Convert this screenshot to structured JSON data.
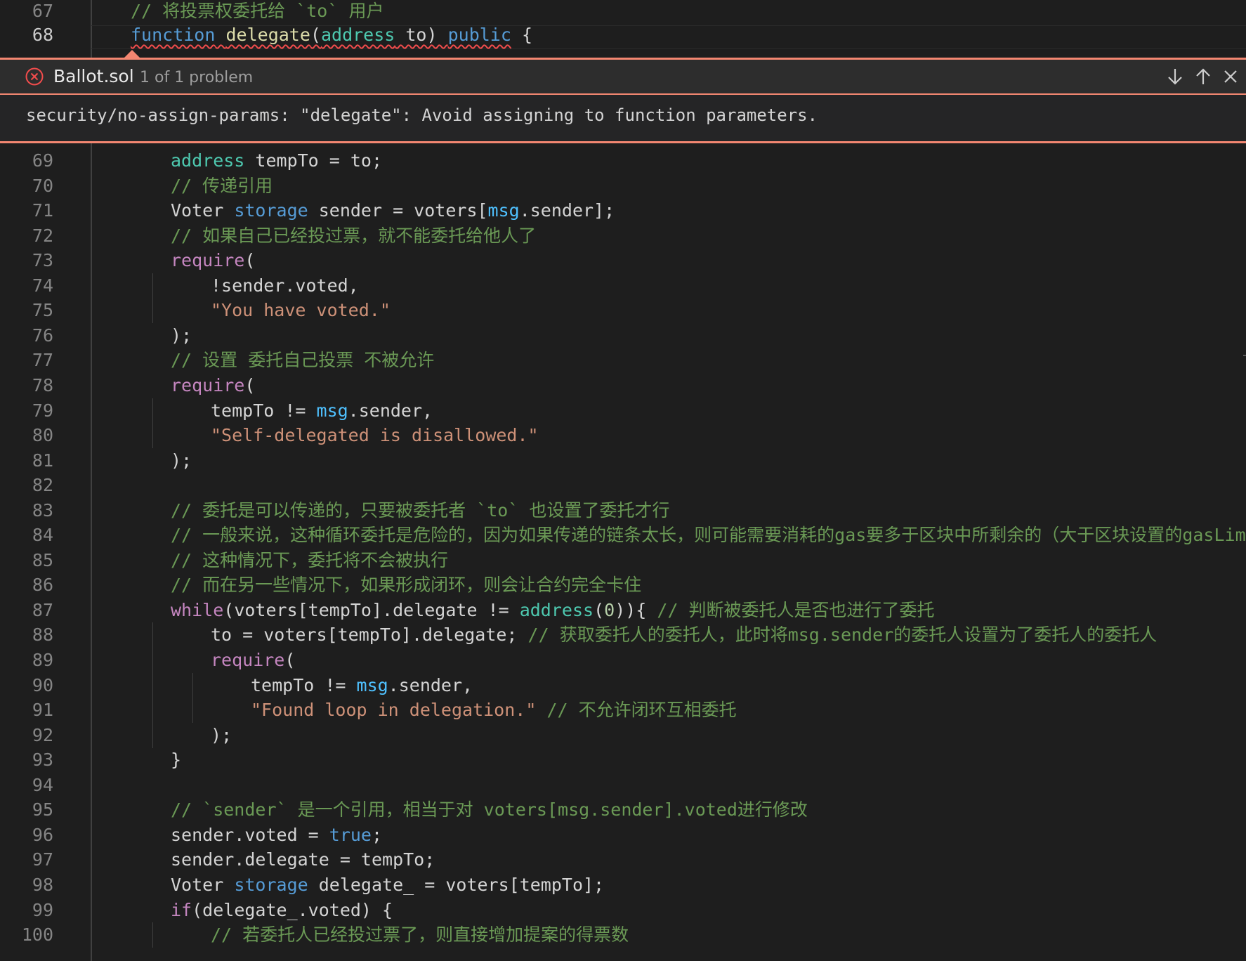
{
  "editor": {
    "lines_top": [
      {
        "n": "67",
        "active": false,
        "indent": 0,
        "tokens": [
          [
            "c-cm",
            "// 将投票权委托给 `to` 用户"
          ]
        ]
      },
      {
        "n": "68",
        "active": true,
        "indent": 0,
        "tokens": [
          [
            "c-kw sq",
            "function"
          ],
          [
            "sq",
            " "
          ],
          [
            "c-fn sq",
            "delegate"
          ],
          [
            "sq",
            "("
          ],
          [
            "c-ty sq",
            "address"
          ],
          [
            "sq",
            " to) "
          ],
          [
            "c-kw sq",
            "public"
          ],
          [
            "",
            " {"
          ]
        ]
      }
    ],
    "lines": [
      {
        "n": "69",
        "indent": 1,
        "tokens": [
          [
            "c-ty",
            "address"
          ],
          [
            "",
            " tempTo = to;"
          ]
        ]
      },
      {
        "n": "70",
        "indent": 1,
        "tokens": [
          [
            "c-cm",
            "// 传递引用"
          ]
        ]
      },
      {
        "n": "71",
        "indent": 1,
        "tokens": [
          [
            "",
            "Voter "
          ],
          [
            "c-kw",
            "storage"
          ],
          [
            "",
            " sender = voters["
          ],
          [
            "c-var",
            "msg"
          ],
          [
            "",
            ".sender];"
          ]
        ]
      },
      {
        "n": "72",
        "indent": 1,
        "tokens": [
          [
            "c-cm",
            "// 如果自己已经投过票，就不能委托给他人了"
          ]
        ]
      },
      {
        "n": "73",
        "indent": 1,
        "tokens": [
          [
            "c-ctl",
            "require"
          ],
          [
            "",
            "("
          ]
        ]
      },
      {
        "n": "74",
        "indent": 2,
        "tokens": [
          [
            "",
            "!sender.voted,"
          ]
        ]
      },
      {
        "n": "75",
        "indent": 2,
        "tokens": [
          [
            "c-str",
            "\"You have voted.\""
          ]
        ]
      },
      {
        "n": "76",
        "indent": 1,
        "tokens": [
          [
            "",
            ");"
          ]
        ]
      },
      {
        "n": "77",
        "indent": 1,
        "tokens": [
          [
            "c-cm",
            "// 设置 委托自己投票 不被允许"
          ]
        ]
      },
      {
        "n": "78",
        "indent": 1,
        "tokens": [
          [
            "c-ctl",
            "require"
          ],
          [
            "",
            "("
          ]
        ]
      },
      {
        "n": "79",
        "indent": 2,
        "tokens": [
          [
            "",
            "tempTo != "
          ],
          [
            "c-var",
            "msg"
          ],
          [
            "",
            ".sender,"
          ]
        ]
      },
      {
        "n": "80",
        "indent": 2,
        "tokens": [
          [
            "c-str",
            "\"Self-delegated is disallowed.\""
          ]
        ]
      },
      {
        "n": "81",
        "indent": 1,
        "tokens": [
          [
            "",
            ");"
          ]
        ]
      },
      {
        "n": "82",
        "indent": 1,
        "tokens": []
      },
      {
        "n": "83",
        "indent": 1,
        "tokens": [
          [
            "c-cm",
            "// 委托是可以传递的，只要被委托者 `to` 也设置了委托才行"
          ]
        ]
      },
      {
        "n": "84",
        "indent": 1,
        "tokens": [
          [
            "c-cm",
            "// 一般来说，这种循环委托是危险的，因为如果传递的链条太长，则可能需要消耗的gas要多于区块中所剩余的（大于区块设置的gasLimit）"
          ]
        ]
      },
      {
        "n": "85",
        "indent": 1,
        "tokens": [
          [
            "c-cm",
            "// 这种情况下，委托将不会被执行"
          ]
        ]
      },
      {
        "n": "86",
        "indent": 1,
        "tokens": [
          [
            "c-cm",
            "// 而在另一些情况下，如果形成闭环，则会让合约完全卡住"
          ]
        ]
      },
      {
        "n": "87",
        "indent": 1,
        "tokens": [
          [
            "c-ctl",
            "while"
          ],
          [
            "",
            "(voters[tempTo].delegate != "
          ],
          [
            "c-ty",
            "address"
          ],
          [
            "",
            "("
          ],
          [
            "c-num",
            "0"
          ],
          [
            "",
            ")){ "
          ],
          [
            "c-cm",
            "// 判断被委托人是否也进行了委托"
          ]
        ]
      },
      {
        "n": "88",
        "indent": 2,
        "tokens": [
          [
            "",
            "to = voters[tempTo].delegate; "
          ],
          [
            "c-cm",
            "// 获取委托人的委托人，此时将msg.sender的委托人设置为了委托人的委托人"
          ]
        ]
      },
      {
        "n": "89",
        "indent": 2,
        "tokens": [
          [
            "c-ctl",
            "require"
          ],
          [
            "",
            "("
          ]
        ]
      },
      {
        "n": "90",
        "indent": 3,
        "tokens": [
          [
            "",
            "tempTo != "
          ],
          [
            "c-var",
            "msg"
          ],
          [
            "",
            ".sender,"
          ]
        ]
      },
      {
        "n": "91",
        "indent": 3,
        "tokens": [
          [
            "c-str",
            "\"Found loop in delegation.\""
          ],
          [
            "",
            " "
          ],
          [
            "c-cm",
            "// 不允许闭环互相委托"
          ]
        ]
      },
      {
        "n": "92",
        "indent": 2,
        "tokens": [
          [
            "",
            ");"
          ]
        ]
      },
      {
        "n": "93",
        "indent": 1,
        "tokens": [
          [
            "",
            "}"
          ]
        ]
      },
      {
        "n": "94",
        "indent": 1,
        "tokens": []
      },
      {
        "n": "95",
        "indent": 1,
        "tokens": [
          [
            "c-cm",
            "// `sender` 是一个引用，相当于对 voters[msg.sender].voted进行修改"
          ]
        ]
      },
      {
        "n": "96",
        "indent": 1,
        "tokens": [
          [
            "",
            "sender.voted = "
          ],
          [
            "c-kw",
            "true"
          ],
          [
            "",
            ";"
          ]
        ]
      },
      {
        "n": "97",
        "indent": 1,
        "tokens": [
          [
            "",
            "sender.delegate = tempTo;"
          ]
        ]
      },
      {
        "n": "98",
        "indent": 1,
        "tokens": [
          [
            "",
            "Voter "
          ],
          [
            "c-kw",
            "storage"
          ],
          [
            "",
            " delegate_ = voters[tempTo];"
          ]
        ]
      },
      {
        "n": "99",
        "indent": 1,
        "tokens": [
          [
            "c-ctl",
            "if"
          ],
          [
            "",
            "(delegate_.voted) {"
          ]
        ]
      },
      {
        "n": "100",
        "indent": 2,
        "tokens": [
          [
            "c-cm",
            "// 若委托人已经投过票了，则直接增加提案的得票数"
          ]
        ]
      }
    ]
  },
  "problem_widget": {
    "file_name": "Ballot.sol",
    "count_text": "1 of 1 problem",
    "message": "security/no-assign-params: \"delegate\": Avoid assigning to function parameters.",
    "icons": {
      "error": "error-circle-icon",
      "next": "arrow-down-icon",
      "previous": "arrow-up-icon",
      "close": "close-icon"
    },
    "accent_color": "#f48771"
  },
  "colors": {
    "background": "#1e1e1e",
    "keyword": "#569cd6",
    "type": "#4ec9b0",
    "control": "#c586c0",
    "string": "#ce9178",
    "comment": "#6a9955",
    "function": "#dcdcaa",
    "error_squiggle": "#f14c4c"
  }
}
